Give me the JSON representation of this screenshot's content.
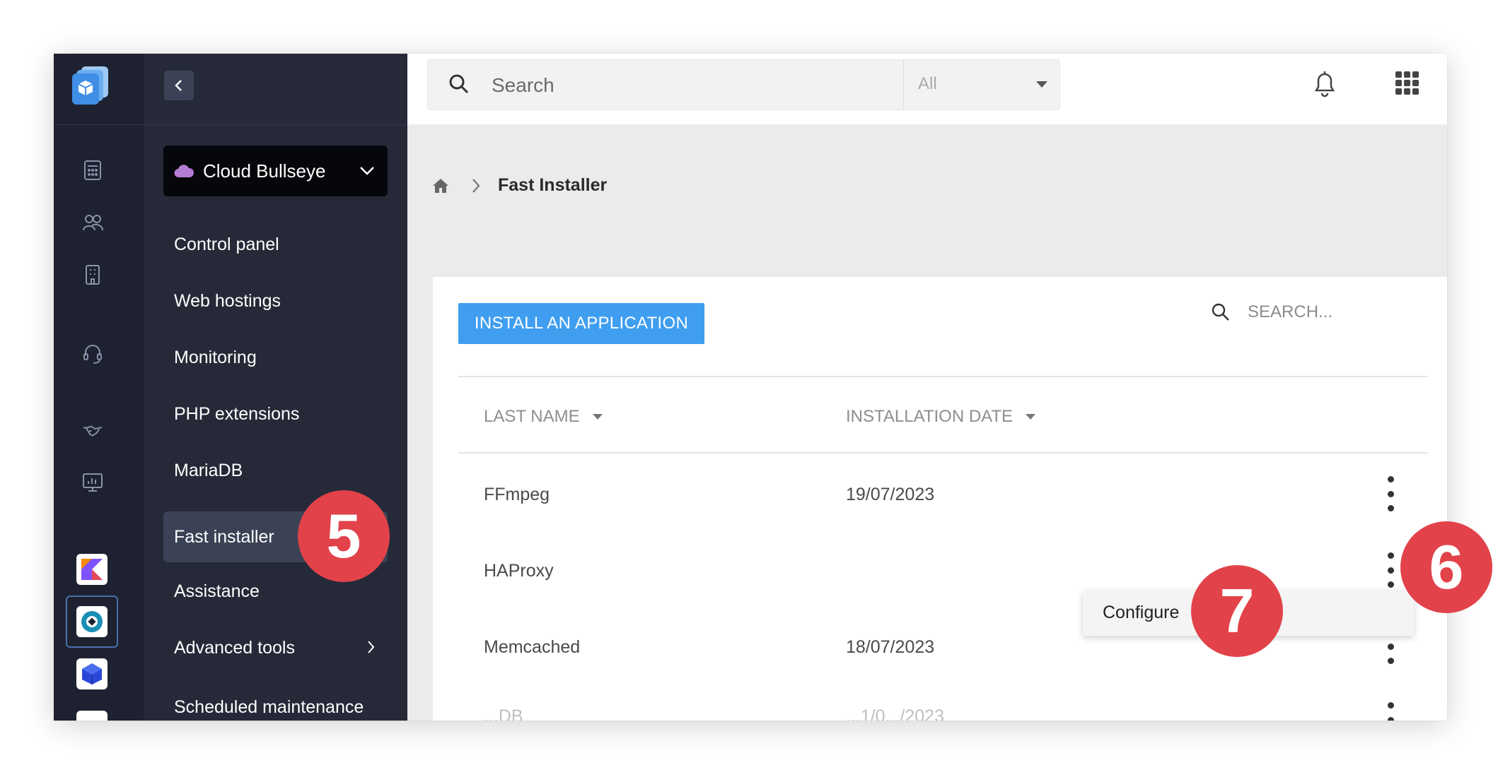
{
  "rail": {
    "icons": [
      "calculator-icon",
      "users-icon",
      "building-icon",
      "headset-icon",
      "handshake-icon",
      "monitor-chart-icon"
    ],
    "apps": [
      "kotlin-app-icon",
      "active-app-icon",
      "cube-app-icon"
    ]
  },
  "nav": {
    "project": "Cloud Bullseye",
    "items": [
      {
        "label": "Control panel"
      },
      {
        "label": "Web hostings"
      },
      {
        "label": "Monitoring"
      },
      {
        "label": "PHP extensions"
      },
      {
        "label": "MariaDB"
      },
      {
        "label": "Fast installer",
        "active": true
      },
      {
        "label": "Assistance"
      },
      {
        "label": "Advanced tools"
      },
      {
        "label": "Scheduled maintenance"
      }
    ]
  },
  "topbar": {
    "search_placeholder": "Search",
    "scope": "All"
  },
  "breadcrumb": {
    "current": "Fast Installer"
  },
  "card": {
    "install_button": "INSTALL AN APPLICATION",
    "search_placeholder": "SEARCH...",
    "columns": [
      "LAST NAME",
      "INSTALLATION DATE"
    ],
    "rows": [
      {
        "name": "FFmpeg",
        "date": "19/07/2023"
      },
      {
        "name": "HAProxy",
        "date": ""
      },
      {
        "name": "Memcached",
        "date": "18/07/2023"
      },
      {
        "name": "...DB",
        "date": "...1/0.../2023"
      }
    ]
  },
  "popup": {
    "item": "Configure"
  },
  "markers": [
    "5",
    "6",
    "7"
  ],
  "colors": {
    "accent": "#3f9ef0",
    "marker": "#e2424a",
    "rail_bg": "#1e2230",
    "nav_bg": "#262a38"
  }
}
